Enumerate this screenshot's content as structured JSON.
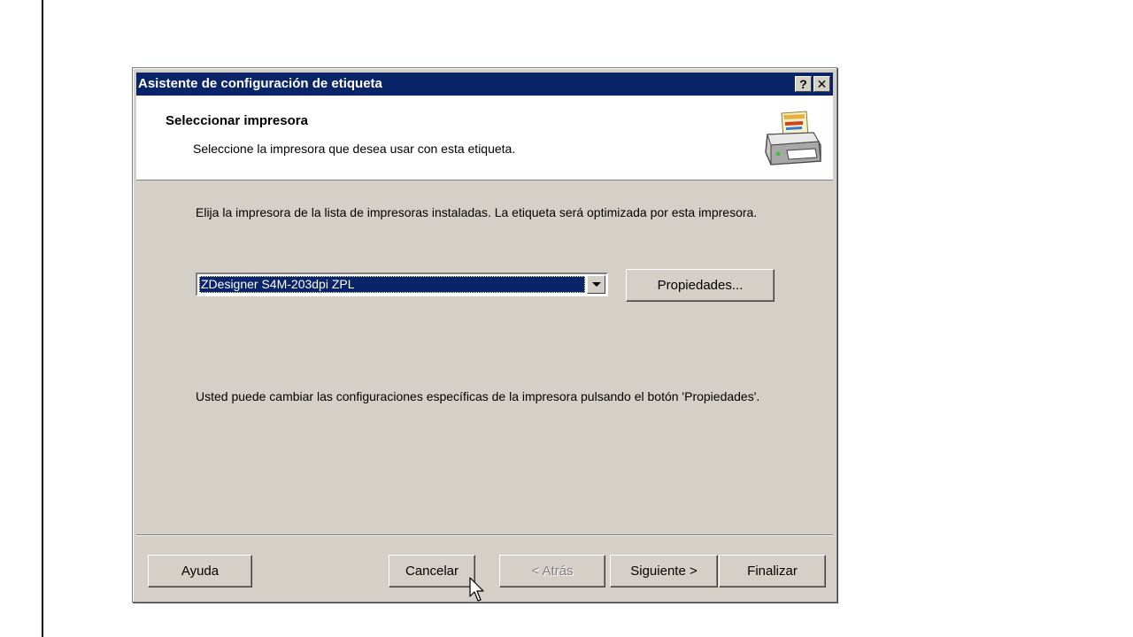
{
  "dialog": {
    "title": "Asistente de configuración de etiqueta",
    "help_glyph": "?",
    "close_glyph": "✕",
    "header": {
      "title": "Seleccionar impresora",
      "subtitle": "Seleccione la impresora que desea usar con esta etiqueta.",
      "icon": "printer-icon"
    },
    "instructions": "Elija la impresora de la lista de impresoras instaladas. La etiqueta será optimizada por esta impresora.",
    "printer_select": {
      "selected": "ZDesigner S4M-203dpi ZPL"
    },
    "properties_button": "Propiedades...",
    "note": "Usted puede cambiar las configuraciones específicas de la impresora pulsando el botón 'Propiedades'.",
    "buttons": {
      "help": "Ayuda",
      "cancel": "Cancelar",
      "back": "< Atrás",
      "next": "Siguiente >",
      "finish": "Finalizar"
    }
  },
  "colors": {
    "titlebar": "#0a246a",
    "dialog_face": "#d4d0c8",
    "selection": "#0a246a"
  }
}
